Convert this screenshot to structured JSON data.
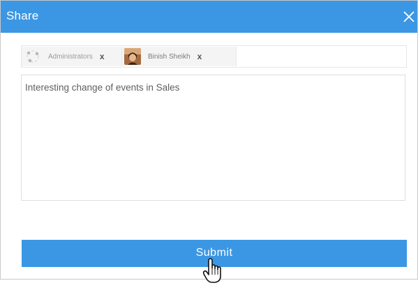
{
  "dialog": {
    "title": "Share",
    "close_icon": "close-icon"
  },
  "recipients": [
    {
      "label": "Administrators",
      "remove": "x",
      "icon": "group-icon"
    },
    {
      "label": "Binish Sheikh",
      "remove": "x",
      "icon": "user-avatar"
    }
  ],
  "message": {
    "value": "Interesting change of events in Sales"
  },
  "submit": {
    "label": "Submit"
  },
  "cursor": {
    "icon": "hand-pointer-icon"
  },
  "colors": {
    "accent": "#3b97e3",
    "chip_bg": "#f4f4f4"
  }
}
